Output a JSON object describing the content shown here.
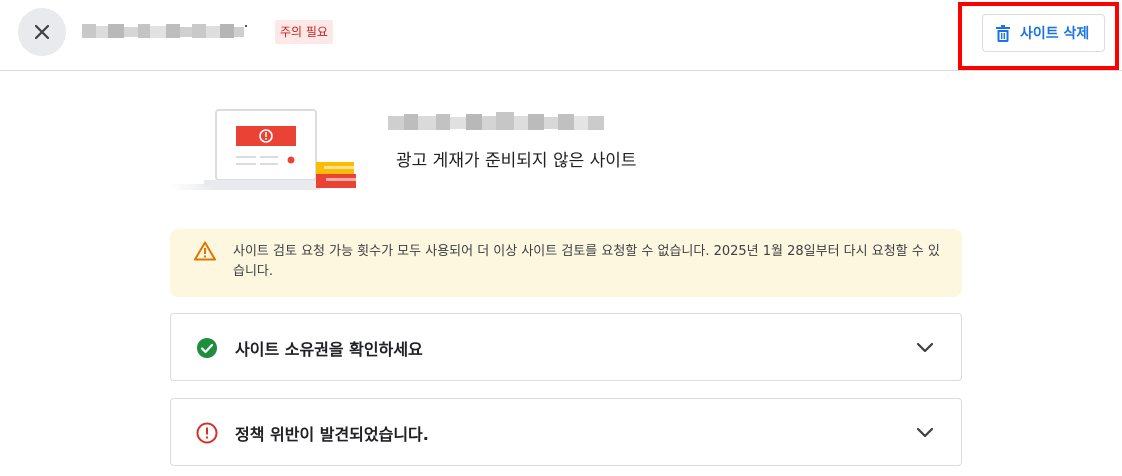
{
  "header": {
    "status_badge": "주의 필요",
    "delete_label": "사이트 삭제"
  },
  "hero": {
    "subtitle": "광고 게재가 준비되지 않은 사이트"
  },
  "warning": {
    "text": "사이트 검토 요청 가능 횟수가 모두 사용되어 더 이상 사이트 검토를 요청할 수 없습니다. 2025년 1월 28일부터 다시 요청할 수 있습니다."
  },
  "accordions": [
    {
      "label": "사이트 소유권을 확인하세요",
      "status": "complete"
    },
    {
      "label": "정책 위반이 발견되었습니다.",
      "status": "error"
    }
  ],
  "colors": {
    "accent": "#1a73e8",
    "success": "#1e8e3e",
    "error": "#d93025",
    "warning_bg": "#fef7e0",
    "warning_icon": "#e37400",
    "highlight_frame": "#ff0000"
  },
  "icons": {
    "close": "close-icon",
    "delete": "trash-icon",
    "warning": "warning-triangle-icon",
    "check": "check-circle-icon",
    "error": "error-circle-icon",
    "expand": "chevron-down-icon"
  }
}
